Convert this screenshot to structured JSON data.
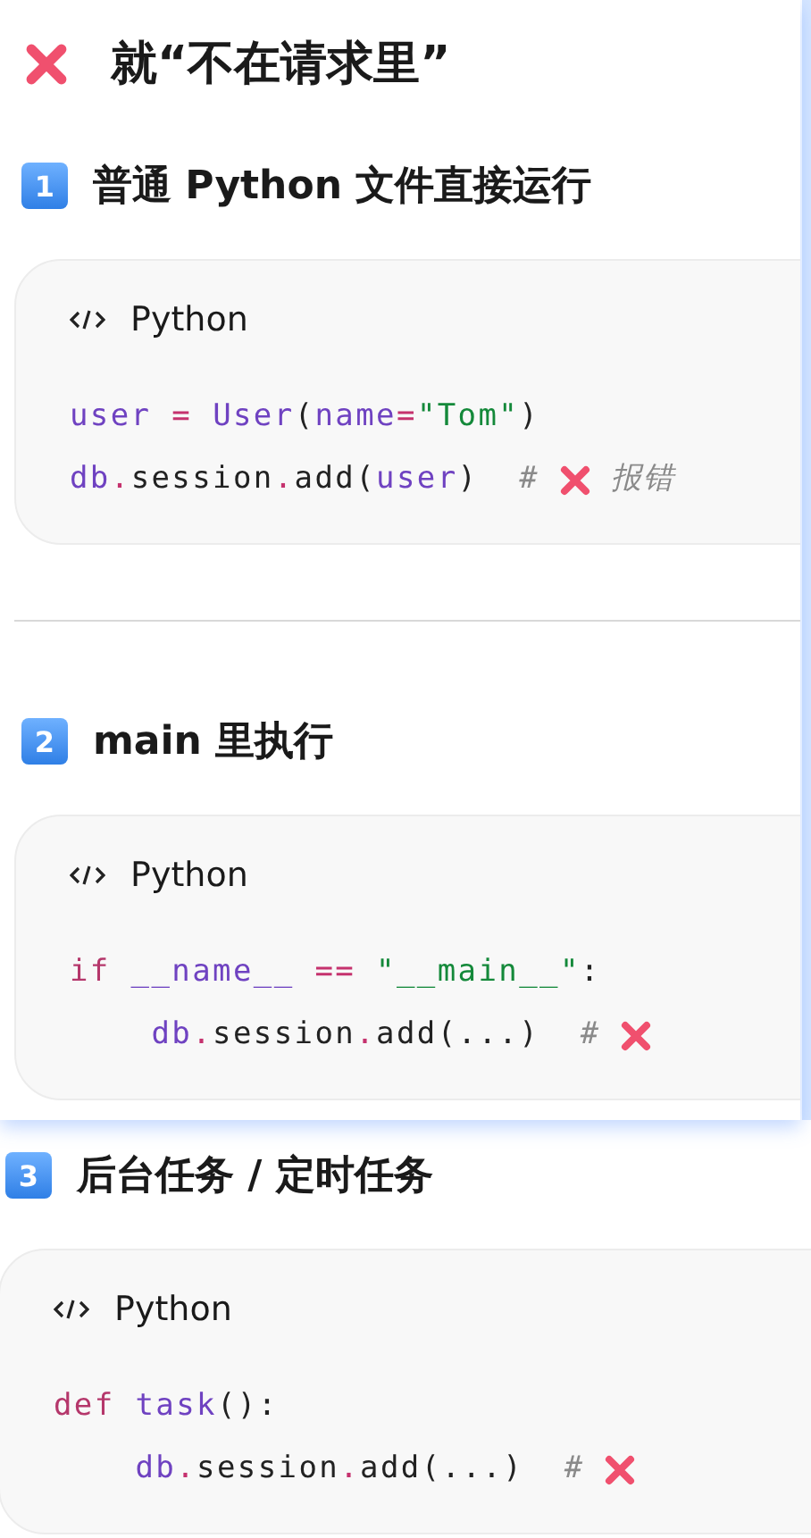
{
  "popup": {
    "title": "就“不在请求里”",
    "sections": [
      {
        "badge": "1",
        "heading": "普通 Python 文件直接运行",
        "language": "Python",
        "lines": [
          [
            {
              "kind": "var",
              "text": "user"
            },
            {
              "kind": "op",
              "text": " = "
            },
            {
              "kind": "var",
              "text": "User"
            },
            {
              "kind": "plain",
              "text": "("
            },
            {
              "kind": "var",
              "text": "name"
            },
            {
              "kind": "op",
              "text": "="
            },
            {
              "kind": "str",
              "text": "\"Tom\""
            },
            {
              "kind": "plain",
              "text": ")"
            }
          ],
          [
            {
              "kind": "var",
              "text": "db"
            },
            {
              "kind": "op",
              "text": "."
            },
            {
              "kind": "plain",
              "text": "session"
            },
            {
              "kind": "op",
              "text": "."
            },
            {
              "kind": "plain",
              "text": "add("
            },
            {
              "kind": "var",
              "text": "user"
            },
            {
              "kind": "plain",
              "text": ")  "
            },
            {
              "kind": "comment",
              "text": "#"
            },
            {
              "kind": "cross"
            },
            {
              "kind": "comment",
              "text": "报错"
            }
          ]
        ]
      },
      {
        "badge": "2",
        "heading": "main 里执行",
        "language": "Python",
        "lines": [
          [
            {
              "kind": "kw",
              "text": "if"
            },
            {
              "kind": "var",
              "text": " __name__"
            },
            {
              "kind": "op",
              "text": " == "
            },
            {
              "kind": "str",
              "text": "\"__main__\""
            },
            {
              "kind": "plain",
              "text": ":"
            }
          ],
          [
            {
              "kind": "var",
              "text": "    db"
            },
            {
              "kind": "op",
              "text": "."
            },
            {
              "kind": "plain",
              "text": "session"
            },
            {
              "kind": "op",
              "text": "."
            },
            {
              "kind": "plain",
              "text": "add(...)  "
            },
            {
              "kind": "comment",
              "text": "#"
            },
            {
              "kind": "cross"
            }
          ]
        ]
      }
    ]
  },
  "page": {
    "sections": [
      {
        "badge": "3",
        "heading": "后台任务 / 定时任务",
        "language": "Python",
        "lines": [
          [
            {
              "kind": "kw",
              "text": "def"
            },
            {
              "kind": "var",
              "text": " task"
            },
            {
              "kind": "plain",
              "text": "():"
            }
          ],
          [
            {
              "kind": "var",
              "text": "    db"
            },
            {
              "kind": "op",
              "text": "."
            },
            {
              "kind": "plain",
              "text": "session"
            },
            {
              "kind": "op",
              "text": "."
            },
            {
              "kind": "plain",
              "text": "add(...)  "
            },
            {
              "kind": "comment",
              "text": "#"
            },
            {
              "kind": "cross"
            }
          ]
        ]
      }
    ]
  }
}
